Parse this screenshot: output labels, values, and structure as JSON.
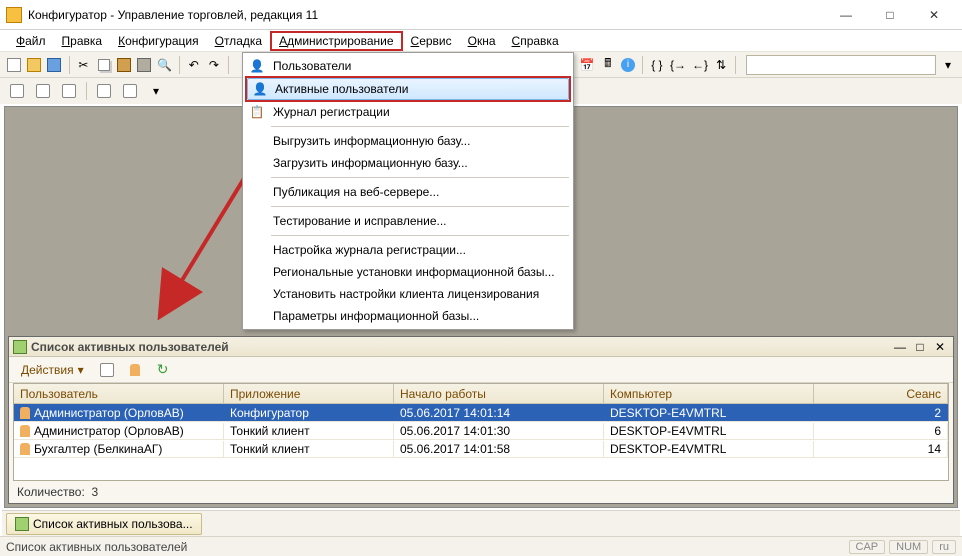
{
  "window": {
    "title": "Конфигуратор - Управление торговлей, редакция 11"
  },
  "menubar": {
    "items": [
      {
        "label": "Файл",
        "u": 0
      },
      {
        "label": "Правка",
        "u": 0
      },
      {
        "label": "Конфигурация",
        "u": 0
      },
      {
        "label": "Отладка",
        "u": 0
      },
      {
        "label": "Администрирование",
        "u": 0,
        "highlighted": true
      },
      {
        "label": "Сервис",
        "u": 0
      },
      {
        "label": "Окна",
        "u": 0
      },
      {
        "label": "Справка",
        "u": 0
      }
    ]
  },
  "dropdown": {
    "items": [
      {
        "label": "Пользователи",
        "icon": "user-icon"
      },
      {
        "label": "Активные пользователи",
        "icon": "users-icon",
        "selected": true,
        "red_border": true
      },
      {
        "label": "Журнал регистрации",
        "icon": "journal-icon"
      },
      {
        "sep": true
      },
      {
        "label": "Выгрузить информационную базу..."
      },
      {
        "label": "Загрузить информационную базу..."
      },
      {
        "sep": true
      },
      {
        "label": "Публикация на веб-сервере..."
      },
      {
        "sep": true
      },
      {
        "label": "Тестирование и исправление..."
      },
      {
        "sep": true
      },
      {
        "label": "Настройка журнала регистрации..."
      },
      {
        "label": "Региональные установки информационной базы..."
      },
      {
        "label": "Установить настройки клиента лицензирования"
      },
      {
        "label": "Параметры информационной базы..."
      }
    ]
  },
  "child_window": {
    "title": "Список активных пользователей",
    "actions_label": "Действия",
    "columns": {
      "user": "Пользователь",
      "app": "Приложение",
      "start": "Начало работы",
      "computer": "Компьютер",
      "session": "Сеанс"
    },
    "rows": [
      {
        "user": "Администратор (ОрловАВ)",
        "app": "Конфигуратор",
        "start": "05.06.2017 14:01:14",
        "computer": "DESKTOP-E4VMTRL",
        "session": "2",
        "selected": true
      },
      {
        "user": "Администратор (ОрловАВ)",
        "app": "Тонкий клиент",
        "start": "05.06.2017 14:01:30",
        "computer": "DESKTOP-E4VMTRL",
        "session": "6"
      },
      {
        "user": "Бухгалтер (БелкинаАГ)",
        "app": "Тонкий клиент",
        "start": "05.06.2017 14:01:58",
        "computer": "DESKTOP-E4VMTRL",
        "session": "14"
      }
    ],
    "count_label": "Количество:",
    "count_value": "3"
  },
  "taskbar": {
    "button": "Список активных пользова..."
  },
  "statusbar": {
    "hint": "Список активных пользователей",
    "cap": "CAP",
    "num": "NUM",
    "lang": "ru"
  }
}
